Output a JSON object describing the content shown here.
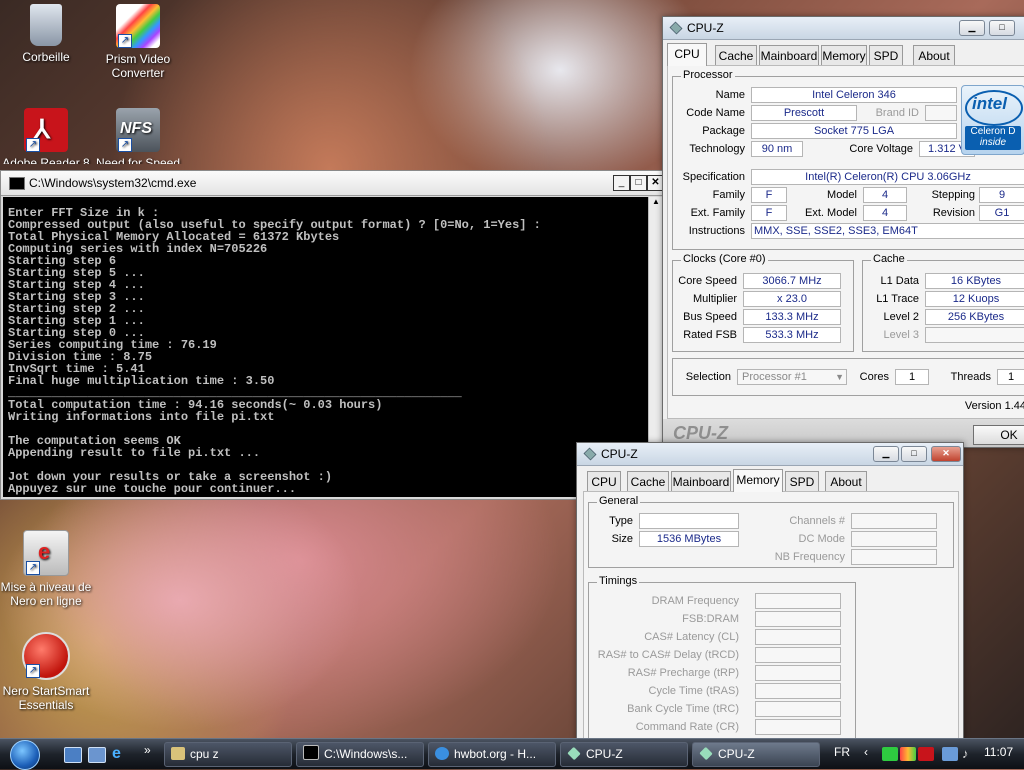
{
  "desktop": {
    "icons": [
      {
        "label": "Corbeille",
        "icon": "recycle-bin-icon"
      },
      {
        "label": "Prism Video Converter",
        "icon": "prism-icon"
      },
      {
        "label": "Adobe Reader 8",
        "icon": "adobe-reader-icon"
      },
      {
        "label": "Need for Speed",
        "icon": "nfs-icon"
      },
      {
        "label": "Mise à niveau de Nero en ligne",
        "icon": "nero-update-icon"
      },
      {
        "label": "Nero StartSmart Essentials",
        "icon": "nero-startsmart-icon"
      }
    ]
  },
  "cmd": {
    "title": "C:\\Windows\\system32\\cmd.exe",
    "lines": [
      "Enter FFT Size in k :",
      "Compressed output (also useful to specify output format) ? [0=No, 1=Yes] :",
      "Total Physical Memory Allocated = 61372 Kbytes",
      "Computing series with index N=705226",
      "Starting step 6",
      "Starting step 5 ...",
      "Starting step 4 ...",
      "Starting step 3 ...",
      "Starting step 2 ...",
      "Starting step 1 ...",
      "Starting step 0 ...",
      "Series computing time : 76.19",
      "Division time : 8.75",
      "InvSqrt time : 5.41",
      "Final huge multiplication time : 3.50",
      "_______________________________________________________________",
      "Total computation time : 94.16 seconds(~ 0.03 hours)",
      "Writing informations into file pi.txt",
      "",
      "The computation seems OK",
      "Appending result to file pi.txt ...",
      "",
      "Jot down your results or take a screenshot :)",
      "Appuyez sur une touche pour continuer..."
    ]
  },
  "cpuz_main": {
    "title": "CPU-Z",
    "tabs": [
      "CPU",
      "Cache",
      "Mainboard",
      "Memory",
      "SPD",
      "About"
    ],
    "active_tab": "CPU",
    "processor": {
      "legend": "Processor",
      "name_label": "Name",
      "name": "Intel Celeron 346",
      "codename_label": "Code Name",
      "codename": "Prescott",
      "brandid_label": "Brand ID",
      "brandid": "",
      "package_label": "Package",
      "package": "Socket 775 LGA",
      "technology_label": "Technology",
      "technology": "90 nm",
      "corevoltage_label": "Core Voltage",
      "corevoltage": "1.312 V",
      "spec_label": "Specification",
      "spec": "Intel(R) Celeron(R) CPU 3.06GHz",
      "family_label": "Family",
      "family": "F",
      "model_label": "Model",
      "model": "4",
      "stepping_label": "Stepping",
      "stepping": "9",
      "extfamily_label": "Ext. Family",
      "extfamily": "F",
      "extmodel_label": "Ext. Model",
      "extmodel": "4",
      "revision_label": "Revision",
      "revision": "G1",
      "instructions_label": "Instructions",
      "instructions": "MMX, SSE, SSE2, SSE3, EM64T"
    },
    "logo": {
      "brand": "intel",
      "line1": "Celeron D",
      "line2": "inside"
    },
    "clocks": {
      "legend": "Clocks (Core #0)",
      "corespeed_label": "Core Speed",
      "corespeed": "3066.7 MHz",
      "multiplier_label": "Multiplier",
      "multiplier": "x 23.0",
      "busspeed_label": "Bus Speed",
      "busspeed": "133.3 MHz",
      "ratedfsb_label": "Rated FSB",
      "ratedfsb": "533.3 MHz"
    },
    "cache": {
      "legend": "Cache",
      "l1data_label": "L1 Data",
      "l1data": "16 KBytes",
      "l1trace_label": "L1 Trace",
      "l1trace": "12 Kuops",
      "level2_label": "Level 2",
      "level2": "256 KBytes",
      "level3_label": "Level 3",
      "level3": ""
    },
    "selection_label": "Selection",
    "selection": "Processor #1",
    "cores_label": "Cores",
    "cores": "1",
    "threads_label": "Threads",
    "threads": "1",
    "version": "Version 1.44",
    "watermark": "CPU-Z",
    "ok_label": "OK"
  },
  "cpuz_mem": {
    "title": "CPU-Z",
    "tabs": [
      "CPU",
      "Cache",
      "Mainboard",
      "Memory",
      "SPD",
      "About"
    ],
    "active_tab": "Memory",
    "general": {
      "legend": "General",
      "type_label": "Type",
      "type": "",
      "size_label": "Size",
      "size": "1536 MBytes",
      "channels_label": "Channels #",
      "dcmode_label": "DC Mode",
      "nbfreq_label": "NB Frequency"
    },
    "timings": {
      "legend": "Timings",
      "rows": [
        "DRAM Frequency",
        "FSB:DRAM",
        "CAS# Latency (CL)",
        "RAS# to CAS# Delay (tRCD)",
        "RAS# Precharge (tRP)",
        "Cycle Time (tRAS)",
        "Bank Cycle Time (tRC)",
        "Command Rate (CR)"
      ]
    }
  },
  "taskbar": {
    "tasks": [
      {
        "label": "cpu z",
        "icon": "folder-icon"
      },
      {
        "label": "C:\\Windows\\s...",
        "icon": "cmd-icon"
      },
      {
        "label": "hwbot.org - H...",
        "icon": "ie-icon"
      },
      {
        "label": "CPU-Z",
        "icon": "cpuz-icon"
      },
      {
        "label": "CPU-Z",
        "icon": "cpuz-icon"
      }
    ],
    "language": "FR",
    "clock": "11:07"
  }
}
